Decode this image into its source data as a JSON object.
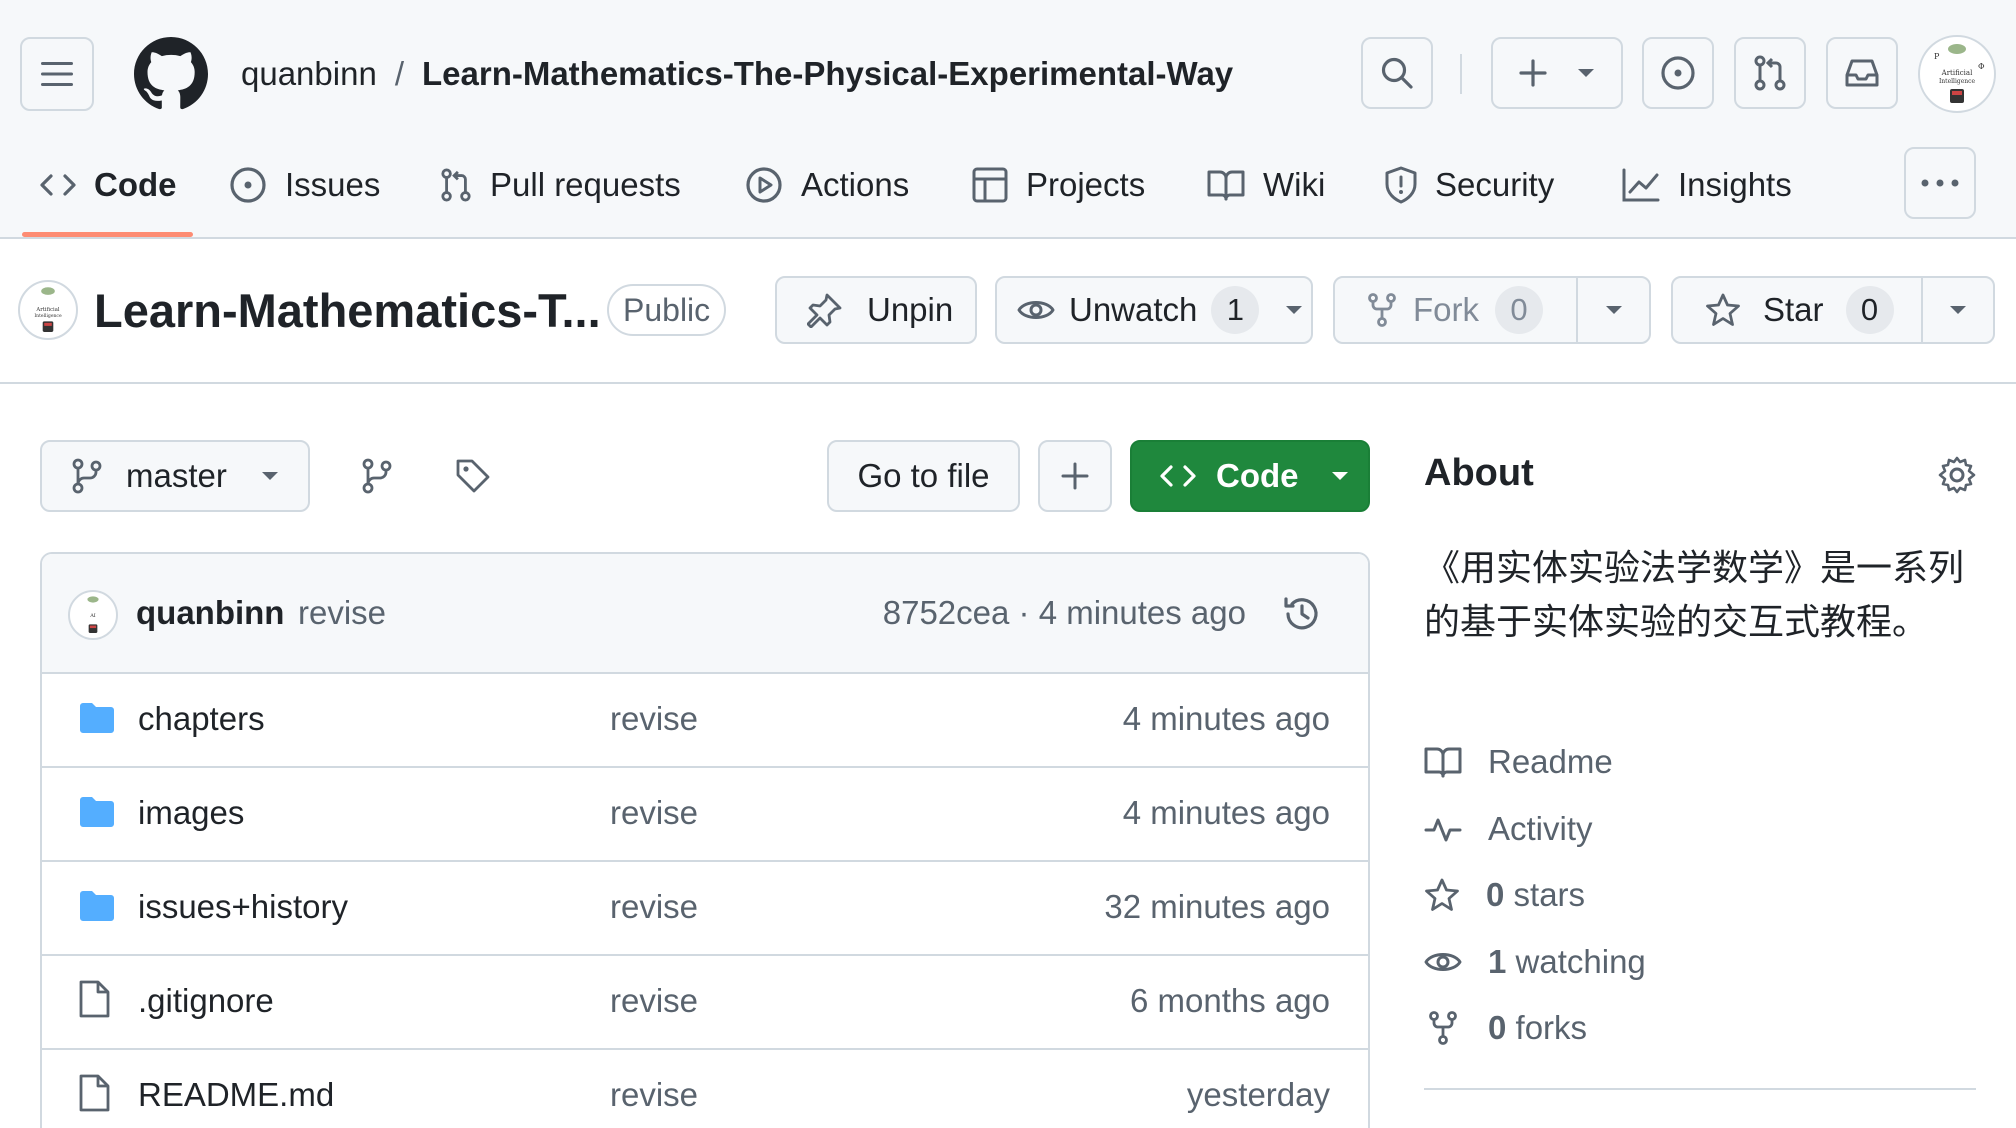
{
  "header": {
    "owner": "quanbinn",
    "separator": "/",
    "repo": "Learn-Mathematics-The-Physical-Experimental-Way"
  },
  "tabs": [
    {
      "label": "Code",
      "icon": "code-icon"
    },
    {
      "label": "Issues",
      "icon": "issue-opened-icon"
    },
    {
      "label": "Pull requests",
      "icon": "git-pull-request-icon"
    },
    {
      "label": "Actions",
      "icon": "play-icon"
    },
    {
      "label": "Projects",
      "icon": "table-icon"
    },
    {
      "label": "Wiki",
      "icon": "book-icon"
    },
    {
      "label": "Security",
      "icon": "shield-icon"
    },
    {
      "label": "Insights",
      "icon": "graph-icon"
    }
  ],
  "repo_bar": {
    "title": "Learn-Mathematics-T...",
    "visibility": "Public",
    "unpin_label": "Unpin",
    "unwatch_label": "Unwatch",
    "watch_count": "1",
    "fork_label": "Fork",
    "fork_count": "0",
    "star_label": "Star",
    "star_count": "0"
  },
  "toolbar": {
    "branch": "master",
    "go_to_file": "Go to file",
    "add_icon": "plus-icon",
    "code_label": "Code"
  },
  "latest_commit": {
    "user": "quanbinn",
    "message": "revise",
    "meta": "8752cea · 4 minutes ago"
  },
  "files": [
    {
      "name": "chapters",
      "type": "folder",
      "message": "revise",
      "time": "4 minutes ago"
    },
    {
      "name": "images",
      "type": "folder",
      "message": "revise",
      "time": "4 minutes ago"
    },
    {
      "name": "issues+history",
      "type": "folder",
      "message": "revise",
      "time": "32 minutes ago"
    },
    {
      "name": ".gitignore",
      "type": "file",
      "message": "revise",
      "time": "6 months ago"
    },
    {
      "name": "README.md",
      "type": "file",
      "message": "revise",
      "time": "yesterday"
    }
  ],
  "about": {
    "heading": "About",
    "description": "《用实体实验法学数学》是一系列的基于实体实验的交互式教程。",
    "readme": "Readme",
    "activity": "Activity",
    "stars_count": "0",
    "stars_label": "stars",
    "watching_count": "1",
    "watching_label": "watching",
    "forks_count": "0",
    "forks_label": "forks"
  },
  "colors": {
    "accent_green": "#1f883d",
    "tab_underline": "#fd8c73",
    "folder_blue": "#54aeff",
    "border": "#d1d9e0",
    "muted_text": "#59636e"
  }
}
